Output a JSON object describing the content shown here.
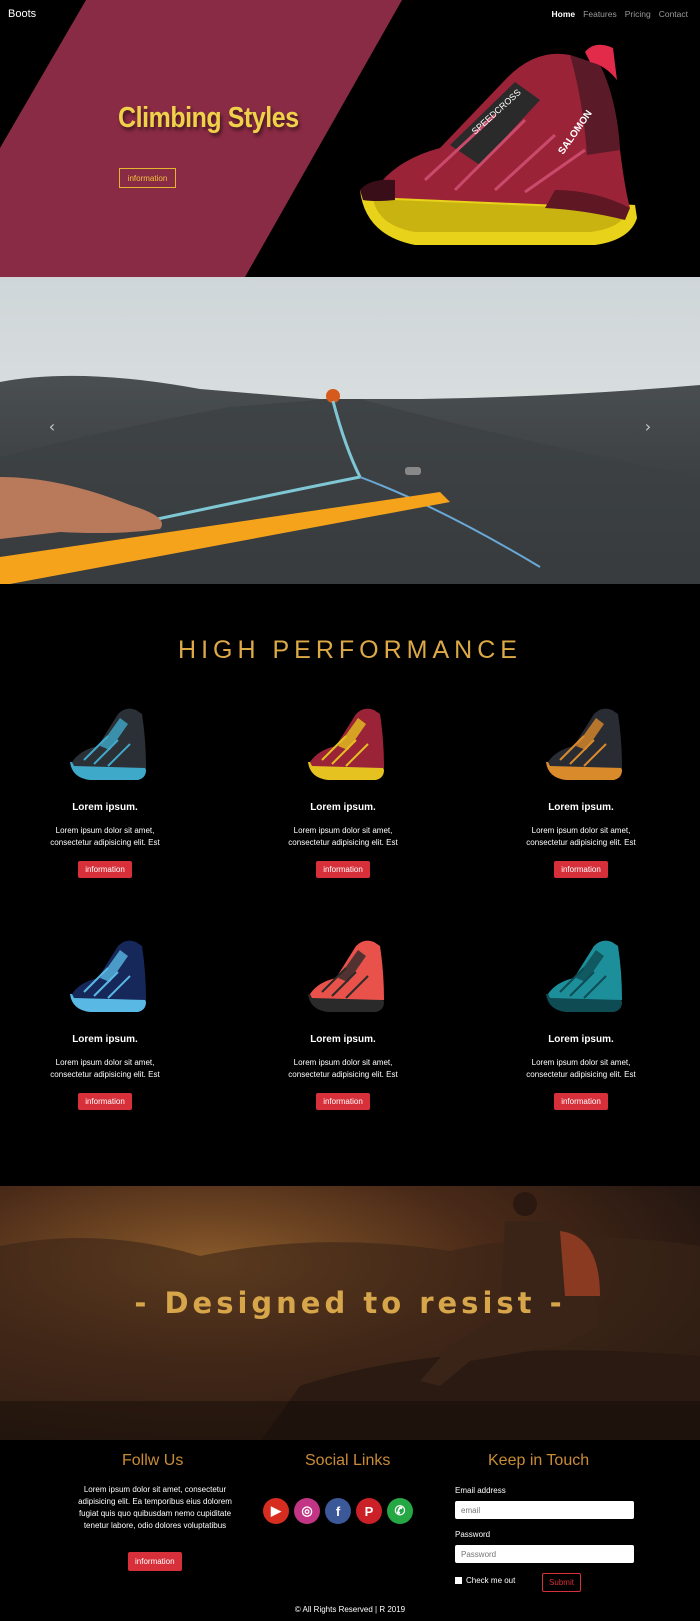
{
  "nav": {
    "brand": "Boots",
    "links": [
      {
        "label": "Home",
        "active": true
      },
      {
        "label": "Features",
        "active": false
      },
      {
        "label": "Pricing",
        "active": false
      },
      {
        "label": "Contact",
        "active": false
      }
    ]
  },
  "hero": {
    "title": "Climbing Styles",
    "button": "information",
    "accent_color": "#8a2b45",
    "title_color": "#f0d24a"
  },
  "carousel": {
    "prev_icon": "chevron-left-icon",
    "next_icon": "chevron-right-icon"
  },
  "performance": {
    "title": "HIGH PERFORMANCE",
    "cards": [
      {
        "title": "Lorem ipsum.",
        "text": "Lorem ipsum dolor sit amet, consectetur adipisicing elit. Est",
        "button": "information",
        "shoe_color": "#2b2f36",
        "shoe_accent": "#3fa9c9"
      },
      {
        "title": "Lorem ipsum.",
        "text": "Lorem ipsum dolor sit amet, consectetur adipisicing elit. Est",
        "button": "information",
        "shoe_color": "#9b2338",
        "shoe_accent": "#e5c21f"
      },
      {
        "title": "Lorem ipsum.",
        "text": "Lorem ipsum dolor sit amet, consectetur adipisicing elit. Est",
        "button": "information",
        "shoe_color": "#2a2c33",
        "shoe_accent": "#d98a2a"
      },
      {
        "title": "Lorem ipsum.",
        "text": "Lorem ipsum dolor sit amet, consectetur adipisicing elit. Est",
        "button": "information",
        "shoe_color": "#16285a",
        "shoe_accent": "#59b8e4"
      },
      {
        "title": "Lorem ipsum.",
        "text": "Lorem ipsum dolor sit amet, consectetur adipisicing elit. Est",
        "button": "information",
        "shoe_color": "#e9524a",
        "shoe_accent": "#2a2a2a"
      },
      {
        "title": "Lorem ipsum.",
        "text": "Lorem ipsum dolor sit amet, consectetur adipisicing elit. Est",
        "button": "information",
        "shoe_color": "#1d8f9b",
        "shoe_accent": "#0e4b52"
      }
    ]
  },
  "banner": {
    "text": "- Designed to resist -"
  },
  "footer": {
    "follow": {
      "title": "Follw Us",
      "text": "Lorem ipsum dolor sit amet, consectetur adipisicing elit. Ea temporibus eius dolorem fugiat quis quo quibusdam nemo cupiditate tenetur labore, odio dolores voluptatibus",
      "button": "information"
    },
    "social": {
      "title": "Social Links",
      "icons": [
        {
          "name": "youtube-icon",
          "glyph": "▶",
          "color": "#d62d20"
        },
        {
          "name": "instagram-icon",
          "glyph": "◎",
          "color": "#c13584"
        },
        {
          "name": "facebook-icon",
          "glyph": "f",
          "color": "#3b5998"
        },
        {
          "name": "pinterest-icon",
          "glyph": "P",
          "color": "#cb2027"
        },
        {
          "name": "whatsapp-icon",
          "glyph": "✆",
          "color": "#25a744"
        }
      ]
    },
    "contact": {
      "title": "Keep in Touch",
      "email_label": "Email address",
      "email_placeholder": "email",
      "password_label": "Password",
      "password_placeholder": "Password",
      "check_label": "Check me out",
      "submit": "Submit"
    },
    "copyright": "© All Rights Reserved | R 2019"
  }
}
